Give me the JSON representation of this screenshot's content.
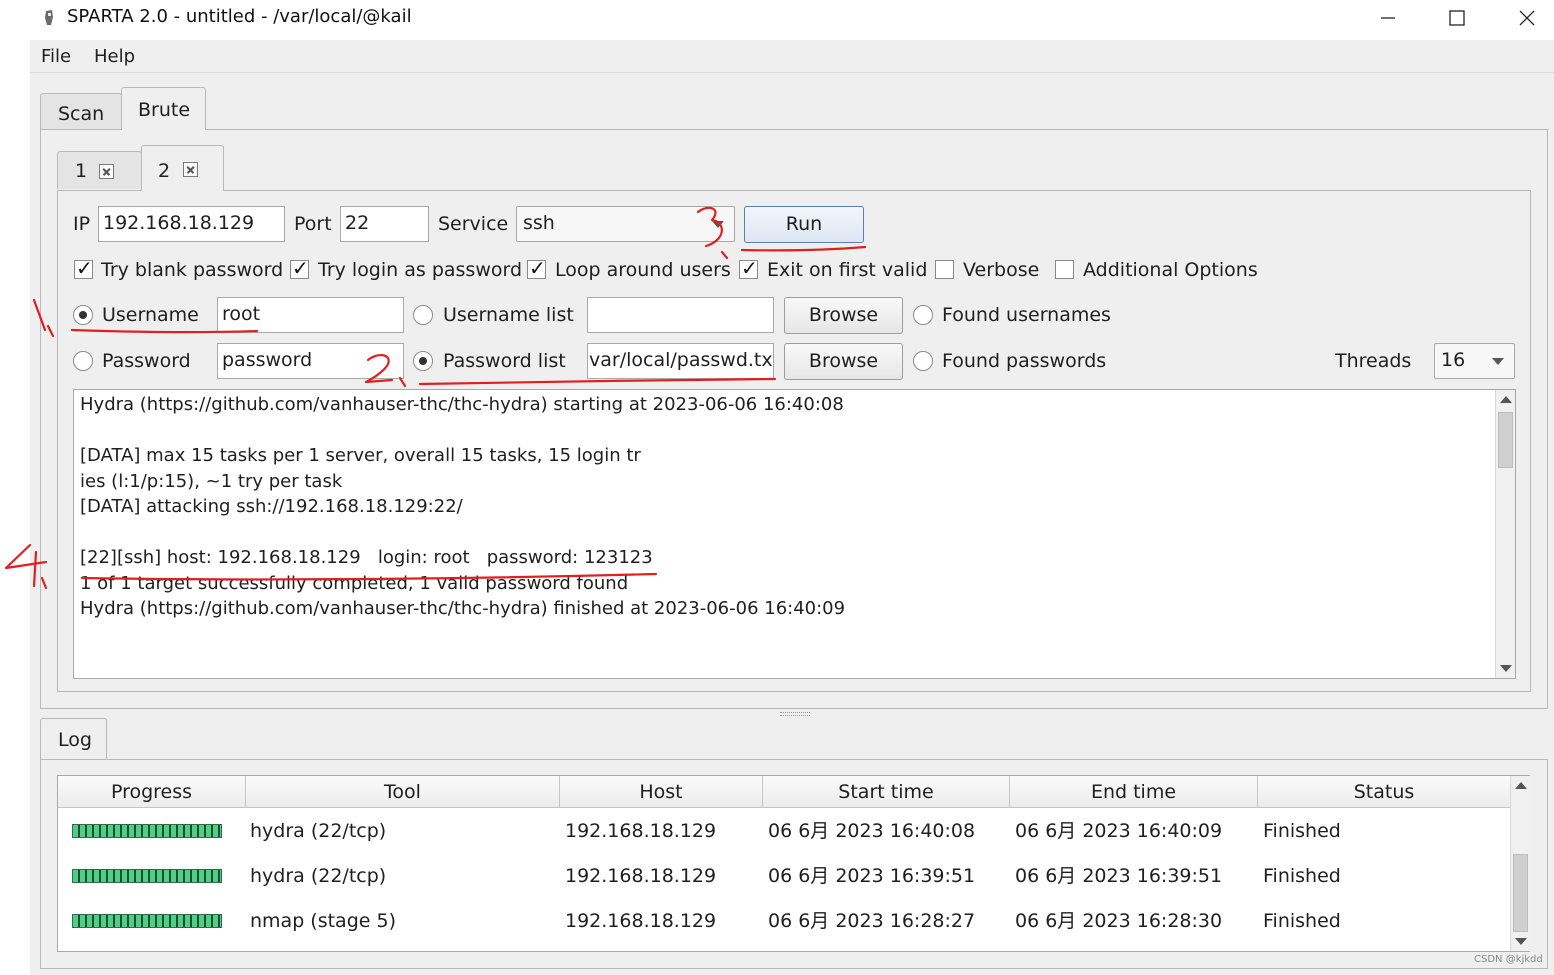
{
  "window": {
    "title": "SPARTA 2.0 - untitled - /var/local/@kail",
    "icon": "sparta-icon",
    "controls": [
      "minimize-icon",
      "maximize-icon",
      "close-icon"
    ]
  },
  "menu": [
    "File",
    "Help"
  ],
  "main_tabs": [
    {
      "label": "Scan"
    },
    {
      "label": "Brute"
    }
  ],
  "brute_tabs": [
    {
      "label": "1"
    },
    {
      "label": "2"
    }
  ],
  "form": {
    "ip_label": "IP",
    "ip_value": "192.168.18.129",
    "port_label": "Port",
    "port_value": "22",
    "service_label": "Service",
    "service_value": "ssh",
    "run_label": "Run",
    "checkboxes": [
      {
        "label": "Try blank password",
        "checked": true
      },
      {
        "label": "Try login as password",
        "checked": true
      },
      {
        "label": "Loop around users",
        "checked": true
      },
      {
        "label": "Exit on first valid",
        "checked": true
      },
      {
        "label": "Verbose",
        "checked": false
      },
      {
        "label": "Additional Options",
        "checked": false
      }
    ],
    "username_label": "Username",
    "username_value": "root",
    "username_list_label": "Username list",
    "username_list_value": "",
    "browse_label": "Browse",
    "found_usernames_label": "Found usernames",
    "password_label": "Password",
    "password_value": "password",
    "password_list_label": "Password list",
    "password_list_value": "var/local/passwd.txt",
    "found_passwords_label": "Found passwords",
    "threads_label": "Threads",
    "threads_value": "16"
  },
  "output_lines": [
    "Hydra (https://github.com/vanhauser-thc/thc-hydra) starting at 2023-06-06 16:40:08",
    "",
    "[DATA] max 15 tasks per 1 server, overall 15 tasks, 15 login tr",
    "ies (l:1/p:15), ~1 try per task",
    "[DATA] attacking ssh://192.168.18.129:22/",
    "",
    "[22][ssh] host: 192.168.18.129   login: root   password: 123123",
    "1 of 1 target successfully completed, 1 valid password found",
    "Hydra (https://github.com/vanhauser-thc/thc-hydra) finished at 2023-06-06 16:40:09"
  ],
  "log": {
    "tab_label": "Log",
    "columns": [
      "Progress",
      "Tool",
      "Host",
      "Start time",
      "End time",
      "Status"
    ],
    "rows": [
      {
        "progress": 100,
        "tool": "hydra (22/tcp)",
        "host": "192.168.18.129",
        "start": "06 6月 2023 16:40:08",
        "end": "06 6月 2023 16:40:09",
        "status": "Finished"
      },
      {
        "progress": 100,
        "tool": "hydra (22/tcp)",
        "host": "192.168.18.129",
        "start": "06 6月 2023 16:39:51",
        "end": "06 6月 2023 16:39:51",
        "status": "Finished"
      },
      {
        "progress": 100,
        "tool": "nmap (stage 5)",
        "host": "192.168.18.129",
        "start": "06 6月 2023 16:28:27",
        "end": "06 6月 2023 16:28:30",
        "status": "Finished"
      }
    ]
  },
  "annotations": {
    "color": "#e02020",
    "marks": [
      "1、",
      "2、",
      "3、",
      "4、"
    ]
  },
  "watermark": "CSDN @kjkdd"
}
